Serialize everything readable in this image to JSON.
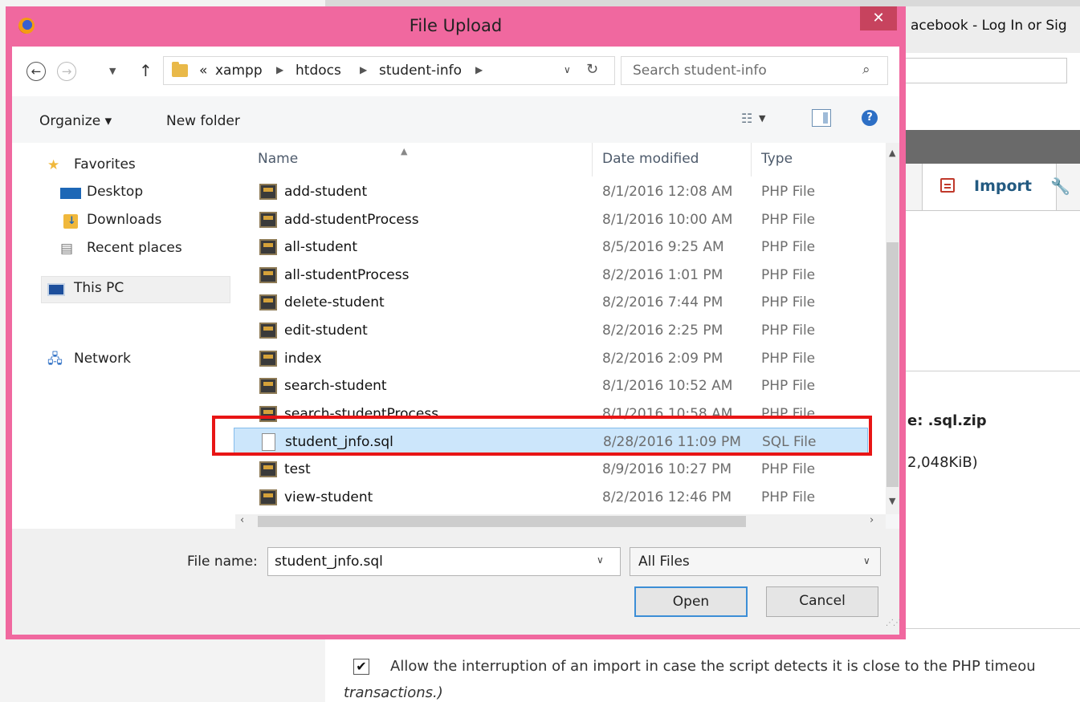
{
  "window": {
    "title": "File Upload",
    "close_glyph": "✕"
  },
  "navigation": {
    "breadcrumb_overflow": "«",
    "breadcrumbs": [
      "xampp",
      "htdocs",
      "student-info"
    ],
    "search_placeholder": "Search student-info"
  },
  "commands": {
    "organize_label": "Organize ▾",
    "new_folder_label": "New folder"
  },
  "sidebar": {
    "favorites": "Favorites",
    "desktop": "Desktop",
    "downloads": "Downloads",
    "recent_places": "Recent places",
    "this_pc": "This PC",
    "network": "Network"
  },
  "columns": {
    "name": "Name",
    "date_modified": "Date modified",
    "type": "Type"
  },
  "files": [
    {
      "name": "add-student",
      "date": "8/1/2016 12:08 AM",
      "type": "PHP File"
    },
    {
      "name": "add-studentProcess",
      "date": "8/1/2016 10:00 AM",
      "type": "PHP File"
    },
    {
      "name": "all-student",
      "date": "8/5/2016 9:25 AM",
      "type": "PHP File"
    },
    {
      "name": "all-studentProcess",
      "date": "8/2/2016 1:01 PM",
      "type": "PHP File"
    },
    {
      "name": "delete-student",
      "date": "8/2/2016 7:44 PM",
      "type": "PHP File"
    },
    {
      "name": "edit-student",
      "date": "8/2/2016 2:25 PM",
      "type": "PHP File"
    },
    {
      "name": "index",
      "date": "8/2/2016 2:09 PM",
      "type": "PHP File"
    },
    {
      "name": "search-student",
      "date": "8/1/2016 10:52 AM",
      "type": "PHP File"
    },
    {
      "name": "search-studentProcess",
      "date": "8/1/2016 10:58 AM",
      "type": "PHP File"
    },
    {
      "name": "student_jnfo.sql",
      "date": "8/28/2016 11:09 PM",
      "type": "SQL File"
    },
    {
      "name": "test",
      "date": "8/9/2016 10:27 PM",
      "type": "PHP File"
    },
    {
      "name": "view-student",
      "date": "8/2/2016 12:46 PM",
      "type": "PHP File"
    }
  ],
  "bottom": {
    "file_name_label": "File name:",
    "file_name_value": "student_jnfo.sql",
    "file_type": "All Files",
    "open_label": "Open",
    "cancel_label": "Cancel"
  },
  "background": {
    "tab_title": "acebook - Log In or Sig",
    "import_label": "Import",
    "format_text": "e: .sql.zip",
    "max_size_text": "2,048KiB)",
    "allow_interrupt_text": "Allow the interruption of an import in case the script detects it is close to the PHP timeou",
    "transactions_text": "transactions.)",
    "checkbox_glyph": "✔"
  }
}
